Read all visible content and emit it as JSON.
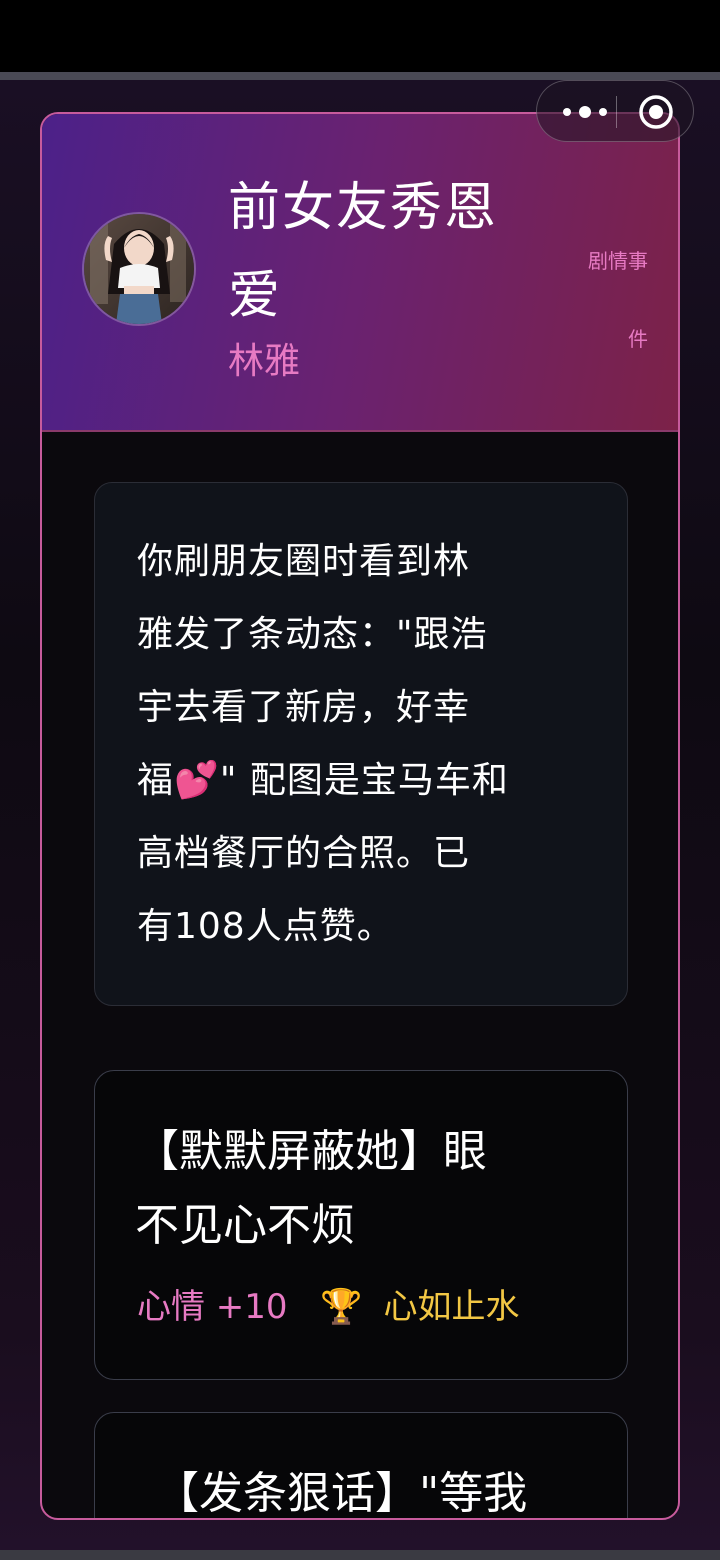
{
  "header": {
    "title_line1": "前女友秀恩",
    "title_line2": "爱",
    "character_name": "林雅",
    "tag_line1": "剧情事",
    "tag_line2": "件"
  },
  "scene": {
    "text": "你刷朋友圈时看到林\n雅发了条动态：\"跟浩\n宇去看了新房，好幸\n福💕\" 配图是宝马车和\n高档餐厅的合照。已\n有108人点赞。"
  },
  "choices": [
    {
      "text": "【默默屏蔽她】眼\n不见心不烦",
      "mood": "心情 +10",
      "trophy_icon": "🏆",
      "achievement": "心如止水"
    },
    {
      "text": "【发条狠话】\"等我"
    }
  ],
  "colors": {
    "accent_pink": "#e77ac3",
    "gold": "#f2c744",
    "border": "#c75b9c"
  }
}
